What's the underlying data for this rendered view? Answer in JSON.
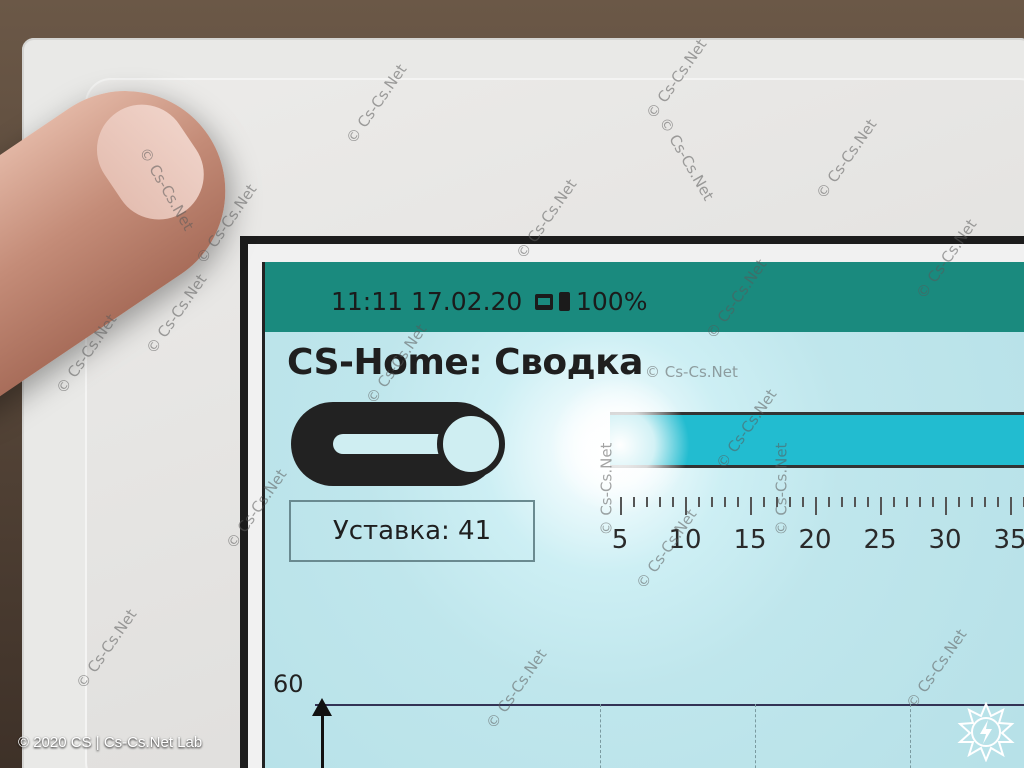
{
  "status_bar": {
    "time_date": "11:11 17.02.20",
    "battery": "100%",
    "icons": [
      "image-icon",
      "battery-icon"
    ]
  },
  "title": "CS-Home: Сводка",
  "toggle": {
    "state": "on"
  },
  "setpoint": "Уставка: 41",
  "scale": {
    "labels": [
      "5",
      "10",
      "15",
      "20",
      "25",
      "30",
      "35"
    ]
  },
  "chart": {
    "y_max_label": "60"
  },
  "watermark": "© Cs-Cs.Net",
  "footer": "© 2020 CS | Cs-Cs.Net Lab",
  "colors": {
    "status_bar": "#1a8a7e",
    "bar_fill": "#22bcd0",
    "screen_bg": "#b9e3ea"
  }
}
